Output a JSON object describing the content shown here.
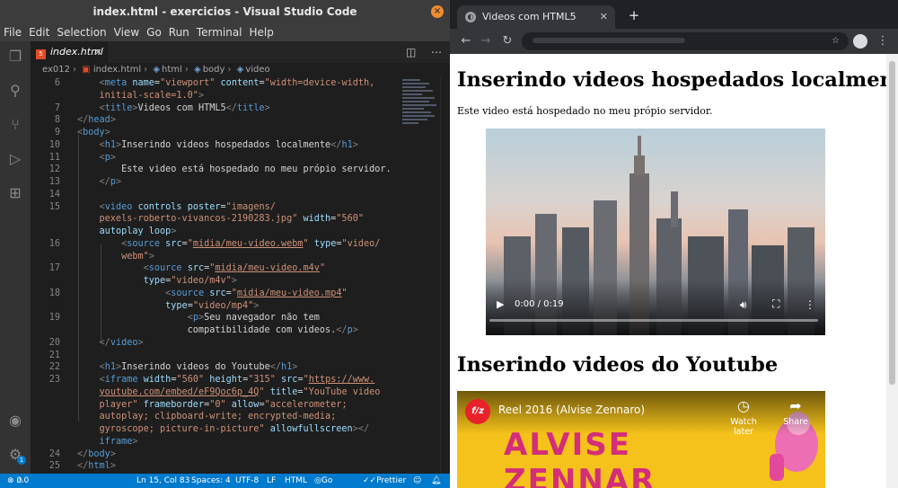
{
  "vscode": {
    "title": "index.html - exercicios - Visual Studio Code",
    "menu": [
      "File",
      "Edit",
      "Selection",
      "View",
      "Go",
      "Run",
      "Terminal",
      "Help"
    ],
    "tab_label": "index.html",
    "breadcrumb": [
      "ex012",
      "index.html",
      "html",
      "body",
      "video"
    ],
    "status": {
      "errors": "0",
      "warnings": "0",
      "position": "Ln 15, Col 83",
      "spaces": "Spaces: 4",
      "encoding": "UTF-8",
      "eol": "LF",
      "language": "HTML",
      "golive": "Go Live",
      "prettier": "Prettier"
    },
    "settings_badge": "1",
    "code": [
      {
        "n": "6",
        "parts": [
          [
            "t",
            "    "
          ],
          [
            "p",
            "<"
          ],
          [
            "k",
            "meta"
          ],
          [
            "t",
            " "
          ],
          [
            "a",
            "name"
          ],
          [
            "t",
            "="
          ],
          [
            "s",
            "\"viewport\""
          ],
          [
            "t",
            " "
          ],
          [
            "a",
            "content"
          ],
          [
            "t",
            "="
          ],
          [
            "s",
            "\"width=device-width,"
          ]
        ]
      },
      {
        "n": "",
        "parts": [
          [
            "s",
            "    initial-scale=1.0\""
          ],
          [
            "p",
            ">"
          ]
        ]
      },
      {
        "n": "7",
        "parts": [
          [
            "t",
            "    "
          ],
          [
            "p",
            "<"
          ],
          [
            "k",
            "title"
          ],
          [
            "p",
            ">"
          ],
          [
            "t",
            "Videos com HTML5"
          ],
          [
            "p",
            "</"
          ],
          [
            "k",
            "title"
          ],
          [
            "p",
            ">"
          ]
        ]
      },
      {
        "n": "8",
        "parts": [
          [
            "p",
            "</"
          ],
          [
            "k",
            "head"
          ],
          [
            "p",
            ">"
          ]
        ]
      },
      {
        "n": "9",
        "parts": [
          [
            "p",
            "<"
          ],
          [
            "k",
            "body"
          ],
          [
            "p",
            ">"
          ]
        ]
      },
      {
        "n": "10",
        "parts": [
          [
            "t",
            "    "
          ],
          [
            "p",
            "<"
          ],
          [
            "k",
            "h1"
          ],
          [
            "p",
            ">"
          ],
          [
            "t",
            "Inserindo videos hospedados localmente"
          ],
          [
            "p",
            "</"
          ],
          [
            "k",
            "h1"
          ],
          [
            "p",
            ">"
          ]
        ]
      },
      {
        "n": "11",
        "parts": [
          [
            "t",
            "    "
          ],
          [
            "p",
            "<"
          ],
          [
            "k",
            "p"
          ],
          [
            "p",
            ">"
          ]
        ]
      },
      {
        "n": "12",
        "parts": [
          [
            "t",
            "        Este video está hospedado no meu própio servidor."
          ]
        ]
      },
      {
        "n": "13",
        "parts": [
          [
            "t",
            "    "
          ],
          [
            "p",
            "</"
          ],
          [
            "k",
            "p"
          ],
          [
            "p",
            ">"
          ]
        ]
      },
      {
        "n": "14",
        "parts": []
      },
      {
        "n": "15",
        "parts": [
          [
            "t",
            "    "
          ],
          [
            "p",
            "<"
          ],
          [
            "k",
            "video"
          ],
          [
            "t",
            " "
          ],
          [
            "a",
            "controls"
          ],
          [
            "t",
            " "
          ],
          [
            "a",
            "poster"
          ],
          [
            "t",
            "="
          ],
          [
            "s",
            "\"imagens/"
          ]
        ]
      },
      {
        "n": "",
        "parts": [
          [
            "s",
            "    pexels-roberto-vivancos-2190283.jpg\""
          ],
          [
            "t",
            " "
          ],
          [
            "a",
            "width"
          ],
          [
            "t",
            "="
          ],
          [
            "s",
            "\"560\""
          ]
        ]
      },
      {
        "n": "",
        "parts": [
          [
            "t",
            "    "
          ],
          [
            "a",
            "autoplay"
          ],
          [
            "t",
            " "
          ],
          [
            "a",
            "loop"
          ],
          [
            "p",
            ">"
          ]
        ]
      },
      {
        "n": "16",
        "parts": [
          [
            "t",
            "        "
          ],
          [
            "p",
            "<"
          ],
          [
            "k",
            "source"
          ],
          [
            "t",
            " "
          ],
          [
            "a",
            "src"
          ],
          [
            "t",
            "="
          ],
          [
            "s",
            "\""
          ],
          [
            "l",
            "midia/meu-video.webm"
          ],
          [
            "s",
            "\""
          ],
          [
            "t",
            " "
          ],
          [
            "a",
            "type"
          ],
          [
            "t",
            "="
          ],
          [
            "s",
            "\"video/"
          ]
        ]
      },
      {
        "n": "",
        "parts": [
          [
            "s",
            "        webm\""
          ],
          [
            "p",
            ">"
          ]
        ]
      },
      {
        "n": "17",
        "parts": [
          [
            "t",
            "            "
          ],
          [
            "p",
            "<"
          ],
          [
            "k",
            "source"
          ],
          [
            "t",
            " "
          ],
          [
            "a",
            "src"
          ],
          [
            "t",
            "="
          ],
          [
            "s",
            "\""
          ],
          [
            "l",
            "midia/meu-video.m4v"
          ],
          [
            "s",
            "\""
          ]
        ]
      },
      {
        "n": "",
        "parts": [
          [
            "t",
            "            "
          ],
          [
            "a",
            "type"
          ],
          [
            "t",
            "="
          ],
          [
            "s",
            "\"video/m4v\""
          ],
          [
            "p",
            ">"
          ]
        ]
      },
      {
        "n": "18",
        "parts": [
          [
            "t",
            "                "
          ],
          [
            "p",
            "<"
          ],
          [
            "k",
            "source"
          ],
          [
            "t",
            " "
          ],
          [
            "a",
            "src"
          ],
          [
            "t",
            "="
          ],
          [
            "s",
            "\""
          ],
          [
            "l",
            "midia/meu-video.mp4"
          ],
          [
            "s",
            "\""
          ]
        ]
      },
      {
        "n": "",
        "parts": [
          [
            "t",
            "                "
          ],
          [
            "a",
            "type"
          ],
          [
            "t",
            "="
          ],
          [
            "s",
            "\"video/mp4\""
          ],
          [
            "p",
            ">"
          ]
        ]
      },
      {
        "n": "19",
        "parts": [
          [
            "t",
            "                    "
          ],
          [
            "p",
            "<"
          ],
          [
            "k",
            "p"
          ],
          [
            "p",
            ">"
          ],
          [
            "t",
            "Seu navegador não tem"
          ]
        ]
      },
      {
        "n": "",
        "parts": [
          [
            "t",
            "                    compatibilidade com videos."
          ],
          [
            "p",
            "</"
          ],
          [
            "k",
            "p"
          ],
          [
            "p",
            ">"
          ]
        ]
      },
      {
        "n": "20",
        "parts": [
          [
            "t",
            "    "
          ],
          [
            "p",
            "</"
          ],
          [
            "k",
            "video"
          ],
          [
            "p",
            ">"
          ]
        ]
      },
      {
        "n": "21",
        "parts": []
      },
      {
        "n": "22",
        "parts": [
          [
            "t",
            "    "
          ],
          [
            "p",
            "<"
          ],
          [
            "k",
            "h1"
          ],
          [
            "p",
            ">"
          ],
          [
            "t",
            "Inserindo videos do Youtube"
          ],
          [
            "p",
            "</"
          ],
          [
            "k",
            "h1"
          ],
          [
            "p",
            ">"
          ]
        ]
      },
      {
        "n": "23",
        "parts": [
          [
            "t",
            "    "
          ],
          [
            "p",
            "<"
          ],
          [
            "k",
            "iframe"
          ],
          [
            "t",
            " "
          ],
          [
            "a",
            "width"
          ],
          [
            "t",
            "="
          ],
          [
            "s",
            "\"560\""
          ],
          [
            "t",
            " "
          ],
          [
            "a",
            "height"
          ],
          [
            "t",
            "="
          ],
          [
            "s",
            "\"315\""
          ],
          [
            "t",
            " "
          ],
          [
            "a",
            "src"
          ],
          [
            "t",
            "="
          ],
          [
            "s",
            "\""
          ],
          [
            "l",
            "https://www."
          ]
        ]
      },
      {
        "n": "",
        "parts": [
          [
            "t",
            "    "
          ],
          [
            "l",
            "youtube.com/embed/eF9Qoc6p_4Q"
          ],
          [
            "s",
            "\""
          ],
          [
            "t",
            " "
          ],
          [
            "a",
            "title"
          ],
          [
            "t",
            "="
          ],
          [
            "s",
            "\"YouTube video"
          ]
        ]
      },
      {
        "n": "",
        "parts": [
          [
            "s",
            "    player\""
          ],
          [
            "t",
            " "
          ],
          [
            "a",
            "frameborder"
          ],
          [
            "t",
            "="
          ],
          [
            "s",
            "\"0\""
          ],
          [
            "t",
            " "
          ],
          [
            "a",
            "allow"
          ],
          [
            "t",
            "="
          ],
          [
            "s",
            "\"accelerometer;"
          ]
        ]
      },
      {
        "n": "",
        "parts": [
          [
            "s",
            "    autoplay; clipboard-write; encrypted-media;"
          ]
        ]
      },
      {
        "n": "",
        "parts": [
          [
            "s",
            "    gyroscope; picture-in-picture\""
          ],
          [
            "t",
            " "
          ],
          [
            "a",
            "allowfullscreen"
          ],
          [
            "p",
            "></"
          ]
        ]
      },
      {
        "n": "",
        "parts": [
          [
            "t",
            "    "
          ],
          [
            "k",
            "iframe"
          ],
          [
            "p",
            ">"
          ]
        ]
      },
      {
        "n": "24",
        "parts": [
          [
            "p",
            "</"
          ],
          [
            "k",
            "body"
          ],
          [
            "p",
            ">"
          ]
        ]
      },
      {
        "n": "25",
        "parts": [
          [
            "p",
            "</"
          ],
          [
            "k",
            "html"
          ],
          [
            "p",
            ">"
          ]
        ]
      }
    ]
  },
  "chrome": {
    "tab_title": "Videos com HTML5",
    "page": {
      "h1_local": "Inserindo videos hospedados localmente",
      "p_local": "Este video está hospedado no meu própio servidor.",
      "video_time": "0:00 / 0:19",
      "h1_youtube": "Inserindo videos do Youtube",
      "yt_logo": "f/z",
      "yt_title": "Reel 2016 (Alvise Zennaro)",
      "yt_watch_later": "Watch later",
      "yt_share": "Share",
      "yt_big_line1": "ALVISE",
      "yt_big_line2": "ZENNAR"
    }
  }
}
